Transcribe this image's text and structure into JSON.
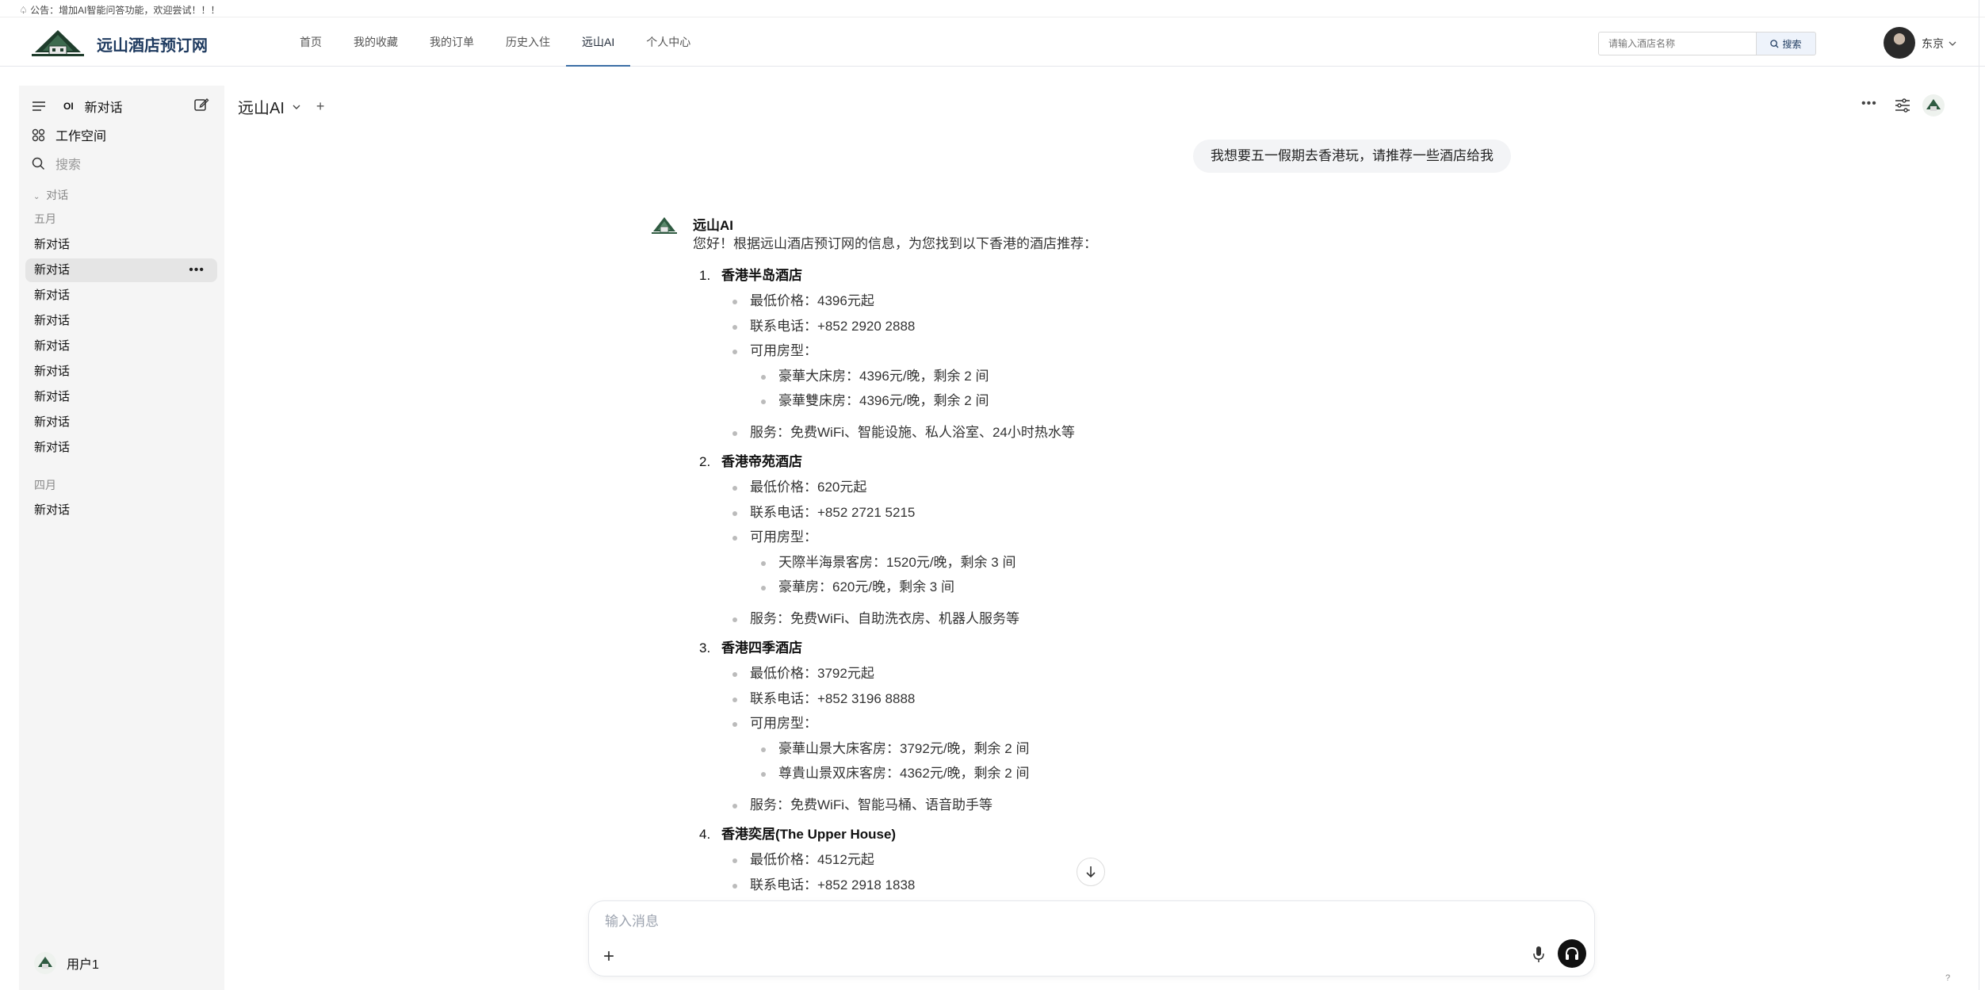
{
  "announcement": "公告：增加AI智能问答功能，欢迎尝试！！！",
  "header": {
    "site_title": "远山酒店预订网",
    "nav": [
      "首页",
      "我的收藏",
      "我的订单",
      "历史入住",
      "远山AI",
      "个人中心"
    ],
    "active_nav": "远山AI",
    "search_placeholder": "请输入酒店名称",
    "search_button": "搜索",
    "user_name": "东京"
  },
  "sidebar": {
    "logo_text": "OI",
    "new_chat": "新对话",
    "workspace": "工作空间",
    "search": "搜索",
    "section_label": "对话",
    "group_may": "五月",
    "may_items": [
      "新对话",
      "新对话",
      "新对话",
      "新对话",
      "新对话",
      "新对话",
      "新对话",
      "新对话",
      "新对话"
    ],
    "group_april": "四月",
    "april_items": [
      "新对话"
    ],
    "footer_user": "用户1"
  },
  "chat": {
    "model_name": "远山AI",
    "user_message": "我想要五一假期去香港玩，请推荐一些酒店给我",
    "ai_name": "远山AI",
    "intro": "您好！根据远山酒店预订网的信息，为您找到以下香港的酒店推荐：",
    "hotels": [
      {
        "num": "1.",
        "name": "香港半岛酒店",
        "price": "最低价格：4396元起",
        "phone": "联系电话：+852 2920 2888",
        "rooms_label": "可用房型：",
        "rooms": [
          "豪華大床房：4396元/晚，剩余 2 间",
          "豪華雙床房：4396元/晚，剩余 2 间"
        ],
        "service": "服务：免费WiFi、智能设施、私人浴室、24小时热水等"
      },
      {
        "num": "2.",
        "name": "香港帝苑酒店",
        "price": "最低价格：620元起",
        "phone": "联系电话：+852 2721 5215",
        "rooms_label": "可用房型：",
        "rooms": [
          "天際半海景客房：1520元/晚，剩余 3 间",
          "豪華房：620元/晚，剩余 3 间"
        ],
        "service": "服务：免费WiFi、自助洗衣房、机器人服务等"
      },
      {
        "num": "3.",
        "name": "香港四季酒店",
        "price": "最低价格：3792元起",
        "phone": "联系电话：+852 3196 8888",
        "rooms_label": "可用房型：",
        "rooms": [
          "豪華山景大床客房：3792元/晚，剩余 2 间",
          "尊貴山景双床客房：4362元/晚，剩余 2 间"
        ],
        "service": "服务：免费WiFi、智能马桶、语音助手等"
      },
      {
        "num": "4.",
        "name": "香港奕居(The Upper House)",
        "price": "最低价格：4512元起",
        "phone": "联系电话：+852 2918 1838",
        "rooms_label": "",
        "rooms": [],
        "service": ""
      }
    ],
    "input_placeholder": "输入消息"
  },
  "help": "?",
  "colors": {
    "brand": "#1e3a5f",
    "active_tab": "#3b6ea5",
    "sidebar_bg": "#f5f5f5"
  }
}
